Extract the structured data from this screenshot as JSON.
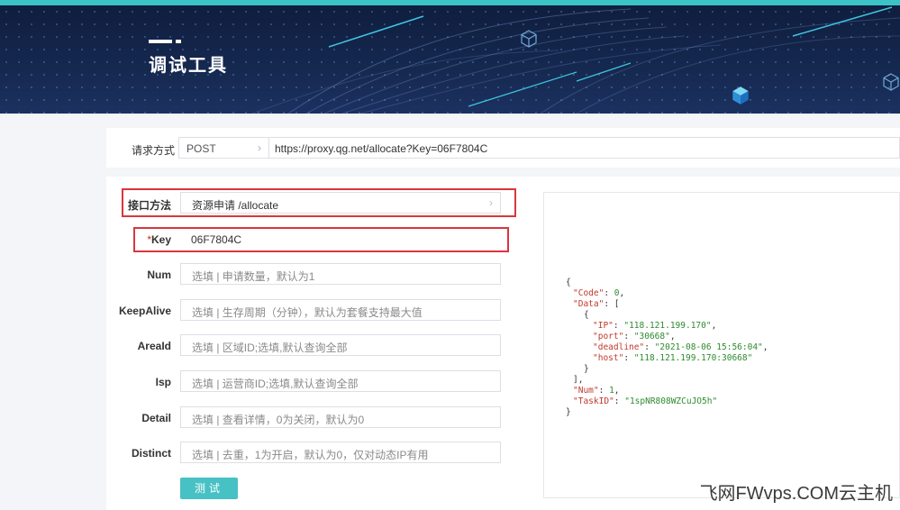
{
  "banner": {
    "title": "调试工具"
  },
  "request": {
    "label": "请求方式",
    "method": "POST",
    "url": "https://proxy.qg.net/allocate?Key=06F7804C"
  },
  "form": {
    "rows": [
      {
        "label": "接口方法",
        "value": "资源申请  /allocate",
        "placeholder": ""
      },
      {
        "star": "*",
        "label": "Key",
        "value": "06F7804C",
        "placeholder": ""
      },
      {
        "label": "Num",
        "value": "",
        "placeholder": "选填 | 申请数量，默认为1"
      },
      {
        "label": "KeepAlive",
        "value": "",
        "placeholder": "选填 | 生存周期（分钟），默认为套餐支持最大值"
      },
      {
        "label": "AreaId",
        "value": "",
        "placeholder": "选填 | 区域ID;选填,默认查询全部"
      },
      {
        "label": "Isp",
        "value": "",
        "placeholder": "选填 | 运营商ID;选填,默认查询全部"
      },
      {
        "label": "Detail",
        "value": "",
        "placeholder": "选填 | 查看详情，0为关闭，默认为0"
      },
      {
        "label": "Distinct",
        "value": "",
        "placeholder": "选填 | 去重，1为开启，默认为0，仅对动态IP有用"
      }
    ],
    "test_button": "测试"
  },
  "result": {
    "open_brace": "{",
    "code_key": "\"Code\"",
    "code_val": "0",
    "data_key": "\"Data\"",
    "inner_open": "{",
    "ip_key": "\"IP\"",
    "ip_val": "\"118.121.199.170\"",
    "port_key": "\"port\"",
    "port_val": "\"30668\"",
    "deadline_key": "\"deadline\"",
    "deadline_val": "\"2021-08-06 15:56:04\"",
    "host_key": "\"host\"",
    "host_val": "\"118.121.199.170:30668\"",
    "inner_close": "}",
    "array_close": "],",
    "num_key": "\"Num\"",
    "num_val": "1",
    "taskid_key": "\"TaskID\"",
    "taskid_val": "\"1spNR808WZCuJO5h\"",
    "close_brace": "}"
  },
  "watermark": "飞网FWvps.COM云主机",
  "colors": {
    "accent": "#47c1c4",
    "highlight": "#d9363e",
    "banner_bg": "#15284f"
  }
}
